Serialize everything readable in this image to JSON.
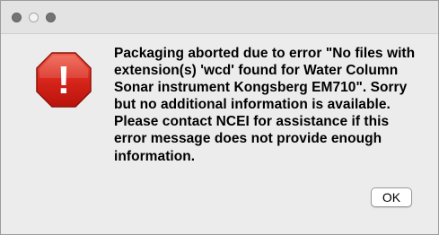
{
  "window": {
    "buttons": {
      "close_icon": "close-icon",
      "minimize_icon": "minimize-icon",
      "zoom_icon": "zoom-icon"
    }
  },
  "dialog": {
    "icon": "error-stop-icon",
    "icon_mark": "!",
    "icon_color": "#d8261b",
    "message": "Packaging aborted due to error \"No files with extension(s) 'wcd' found for  Water Column Sonar instrument Kongsberg EM710\". Sorry but no additional information is available. Please contact NCEI for assistance if this error message does not provide enough information.",
    "ok_label": "OK"
  }
}
